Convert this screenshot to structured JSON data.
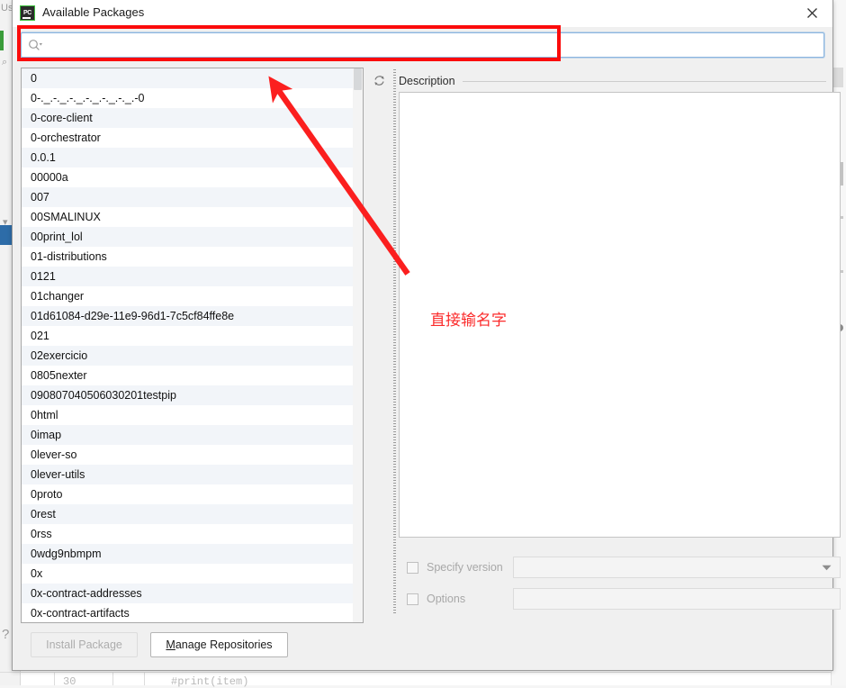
{
  "window": {
    "title": "Available Packages",
    "app_icon": "pycharm-icon",
    "app_icon_text": "PC",
    "close_icon": "close-icon"
  },
  "search": {
    "value": "",
    "placeholder": "",
    "icon": "search-icon"
  },
  "toolbar": {
    "refresh_icon": "refresh-icon"
  },
  "package_list": {
    "items": [
      "0",
      "0-._.-._.-._.-._.-._.-._.-0",
      "0-core-client",
      "0-orchestrator",
      "0.0.1",
      "00000a",
      "007",
      "00SMALINUX",
      "00print_lol",
      "01-distributions",
      "0121",
      "01changer",
      "01d61084-d29e-11e9-96d1-7c5cf84ffe8e",
      "021",
      "02exercicio",
      "0805nexter",
      "090807040506030201testpip",
      "0html",
      "0imap",
      "0lever-so",
      "0lever-utils",
      "0proto",
      "0rest",
      "0rss",
      "0wdg9nbmpm",
      "0x",
      "0x-contract-addresses",
      "0x-contract-artifacts"
    ]
  },
  "description": {
    "title": "Description",
    "body": ""
  },
  "options": {
    "specify_version": {
      "label": "Specify version",
      "checked": false,
      "value": "",
      "dropdown_icon": "chevron-down-icon"
    },
    "options_field": {
      "label": "Options",
      "checked": false,
      "value": ""
    }
  },
  "footer": {
    "install_label": "Install Package",
    "install_enabled": false,
    "manage_mnemonic": "M",
    "manage_rest": "anage Repositories"
  },
  "annotation": {
    "note_text": "直接输名字",
    "highlight_color": "#fb0b0b",
    "arrow_color": "#fb2b2b"
  },
  "background": {
    "tab_label_1": "Us",
    "code_comment": "#print(item)",
    "line_number": "30",
    "help_glyph": "?"
  }
}
